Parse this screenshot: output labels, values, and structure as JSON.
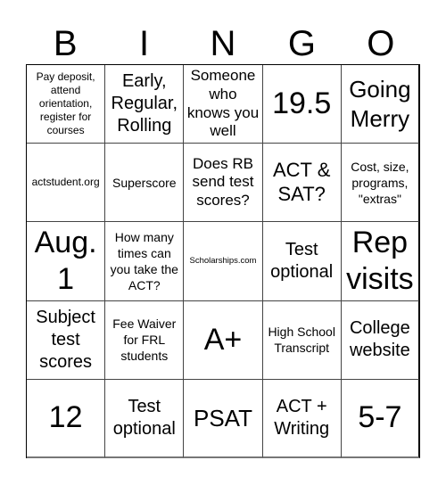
{
  "header": {
    "letters": [
      "B",
      "I",
      "N",
      "G",
      "O"
    ]
  },
  "card": {
    "rows": [
      [
        {
          "text": "Pay deposit, attend orientation, register for courses"
        },
        {
          "text": "Early, Regular, Rolling"
        },
        {
          "text": "Someone who knows you well"
        },
        {
          "text": "19.5"
        },
        {
          "text": "Going Merry"
        }
      ],
      [
        {
          "text": "actstudent.org"
        },
        {
          "text": "Superscore"
        },
        {
          "text": "Does RB send test scores?"
        },
        {
          "text": "ACT & SAT?"
        },
        {
          "text": "Cost, size, programs, \"extras\""
        }
      ],
      [
        {
          "text": "Aug. 1"
        },
        {
          "text": "How many times can you take the ACT?"
        },
        {
          "text": "Scholarships.com"
        },
        {
          "text": "Test optional"
        },
        {
          "text": "Rep visits"
        }
      ],
      [
        {
          "text": "Subject test scores"
        },
        {
          "text": "Fee Waiver for FRL students"
        },
        {
          "text": "A+"
        },
        {
          "text": "High School Transcript"
        },
        {
          "text": "College website"
        }
      ],
      [
        {
          "text": "12"
        },
        {
          "text": "Test optional"
        },
        {
          "text": "PSAT"
        },
        {
          "text": "ACT + Writing"
        },
        {
          "text": "5-7"
        }
      ]
    ]
  }
}
